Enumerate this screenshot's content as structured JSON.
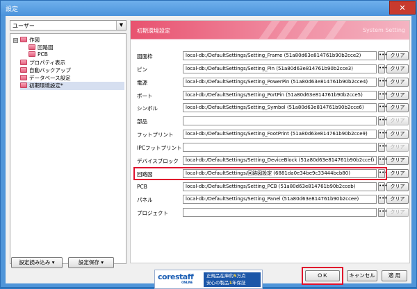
{
  "window": {
    "title": "設定",
    "close_glyph": "✕"
  },
  "category_select": {
    "value": "ユーザー"
  },
  "tree": {
    "items": [
      {
        "label": "作図",
        "level": 0,
        "expander": "⊟"
      },
      {
        "label": "回路図",
        "level": 1
      },
      {
        "label": "PCB",
        "level": 1
      },
      {
        "label": "プロパティ表示",
        "level": 0
      },
      {
        "label": "自動バックアップ",
        "level": 0
      },
      {
        "label": "データベース設定",
        "level": 0
      },
      {
        "label": "初期環境設定*",
        "level": 0,
        "selected": true
      }
    ]
  },
  "left_buttons": {
    "import_label": "設定読み込み ▾",
    "save_label": "設定保存 ▾"
  },
  "panel": {
    "title": "初期環境設定",
    "subtitle": "System Setting"
  },
  "settings_rows": [
    {
      "label": "図面枠",
      "value": "local-db:/DefaultSettings/Setting_Frame (51a80d63e814761b90b2cce2)",
      "clear": "クリア",
      "enabled": true
    },
    {
      "label": "ピン",
      "value": "local-db:/DefaultSettings/Setting_Pin (51a80d63e814761b90b2cce3)",
      "clear": "クリア",
      "enabled": true
    },
    {
      "label": "電源",
      "value": "local-db:/DefaultSettings/Setting_PowerPin (51a80d63e814761b90b2cce4)",
      "clear": "クリア",
      "enabled": true
    },
    {
      "label": "ポート",
      "value": "local-db:/DefaultSettings/Setting_PortPin (51a80d63e814761b90b2cce5)",
      "clear": "クリア",
      "enabled": true
    },
    {
      "label": "シンボル",
      "value": "local-db:/DefaultSettings/Setting_Symbol (51a80d63e814761b90b2cce6)",
      "clear": "クリア",
      "enabled": true
    },
    {
      "label": "部品",
      "value": "",
      "clear": "クリア",
      "enabled": false
    },
    {
      "label": "フットプリント",
      "value": "local-db:/DefaultSettings/Setting_FootPrint (51a80d63e814761b90b2cce9)",
      "clear": "クリア",
      "enabled": true
    },
    {
      "label": "IPCフットプリント",
      "value": "",
      "clear": "クリア",
      "enabled": false
    },
    {
      "label": "デバイスブロック",
      "value": "local-db:/DefaultSettings/Setting_DeviceBlock (51a80d63e814761b90b2ccef)",
      "clear": "クリア",
      "enabled": true
    },
    {
      "label": "回路図",
      "value": "local-db:/DefaultSettings/回路図設定 (6881da0e34be9c33444bcb80)",
      "clear": "クリア",
      "enabled": true,
      "highlighted": true
    },
    {
      "label": "PCB",
      "value": "local-db:/DefaultSettings/Setting_PCB (51a80d63e814761b90b2cceb)",
      "clear": "クリア",
      "enabled": true
    },
    {
      "label": "パネル",
      "value": "local-db:/DefaultSettings/Setting_Panel (51a80d63e814761b90b2ccee)",
      "clear": "クリア",
      "enabled": true
    },
    {
      "label": "プロジェクト",
      "value": "",
      "clear": "クリア",
      "enabled": false
    }
  ],
  "dots_label": "•••",
  "advert": {
    "brand": "corestaff",
    "brand_sub": "ONLINE",
    "line1a": "正規品在庫約",
    "line1num": "5",
    "line1b": "万点",
    "line2a": "安心の製品",
    "line2num": "1",
    "line2b": "年保証"
  },
  "footer_buttons": {
    "ok": "ＯＫ",
    "cancel": "キャンセル",
    "apply": "適 用"
  },
  "colors": {
    "accent": "#e8526f",
    "highlight": "#e0102d"
  }
}
